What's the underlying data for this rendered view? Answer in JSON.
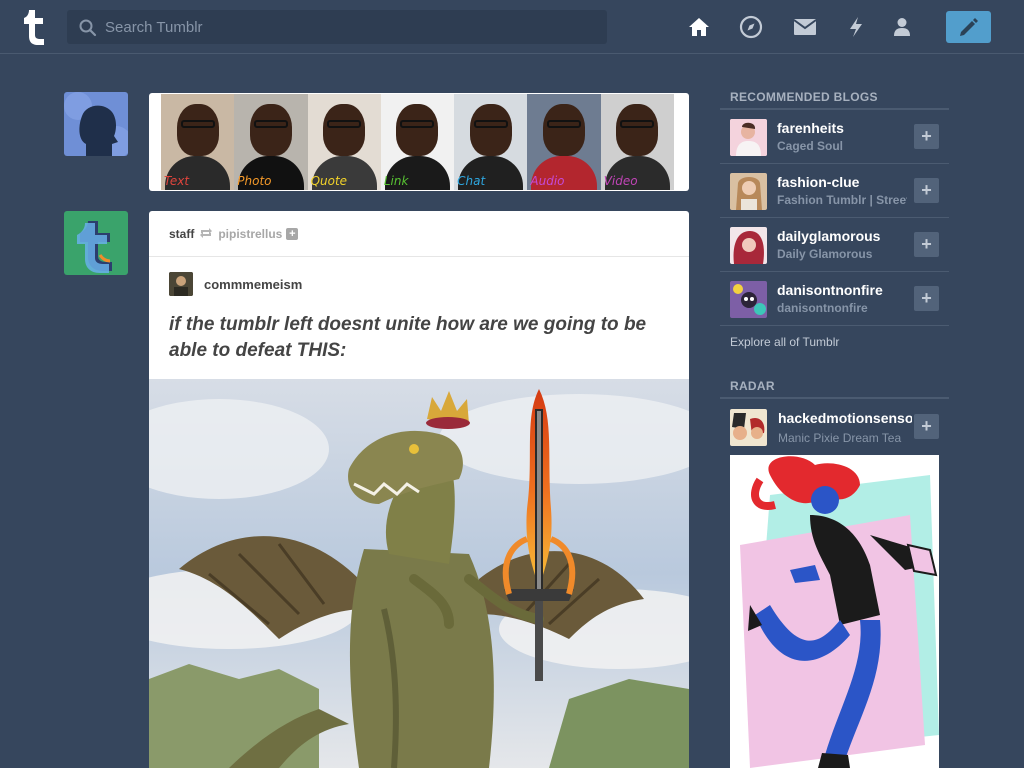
{
  "header": {
    "search_placeholder": "Search Tumblr",
    "logo_letter": "t",
    "nav": [
      "home-icon",
      "explore-icon",
      "inbox-icon",
      "activity-icon",
      "account-icon"
    ],
    "compose_icon": "pencil-icon",
    "accent": "#529ecc",
    "background": "#36465d"
  },
  "post_types": [
    {
      "label": "Text",
      "color": "#e0443c"
    },
    {
      "label": "Photo",
      "color": "#f59a2a"
    },
    {
      "label": "Quote",
      "color": "#f3d329"
    },
    {
      "label": "Link",
      "color": "#57c232"
    },
    {
      "label": "Chat",
      "color": "#2ea6df"
    },
    {
      "label": "Audio",
      "color": "#9b4ddb"
    },
    {
      "label": "Video",
      "color": "#c044b6"
    }
  ],
  "post": {
    "author": "staff",
    "reblogged_from": "pipistrellus",
    "reblog_author": "commmemeism",
    "title": "if the tumblr left doesnt unite how are we going to be able to defeat THIS:"
  },
  "sidebar": {
    "recommended_heading": "RECOMMENDED BLOGS",
    "blogs": [
      {
        "name": "farenheits",
        "title": "Caged Soul",
        "avatar_color": "#e8b8c8"
      },
      {
        "name": "fashion-clue",
        "title": "Fashion Tumblr | Street Style",
        "avatar_color": "#c49a72"
      },
      {
        "name": "dailyglamorous",
        "title": "Daily Glamorous",
        "avatar_color": "#b83a4a"
      },
      {
        "name": "danisontnonfire",
        "title": "danisontnonfire",
        "avatar_color": "#6a5b8e"
      }
    ],
    "explore_label": "Explore all of Tumblr",
    "radar_heading": "RADAR",
    "radar": {
      "name": "hackedmotionsensor",
      "title": "Manic Pixie Dream Tea"
    }
  }
}
